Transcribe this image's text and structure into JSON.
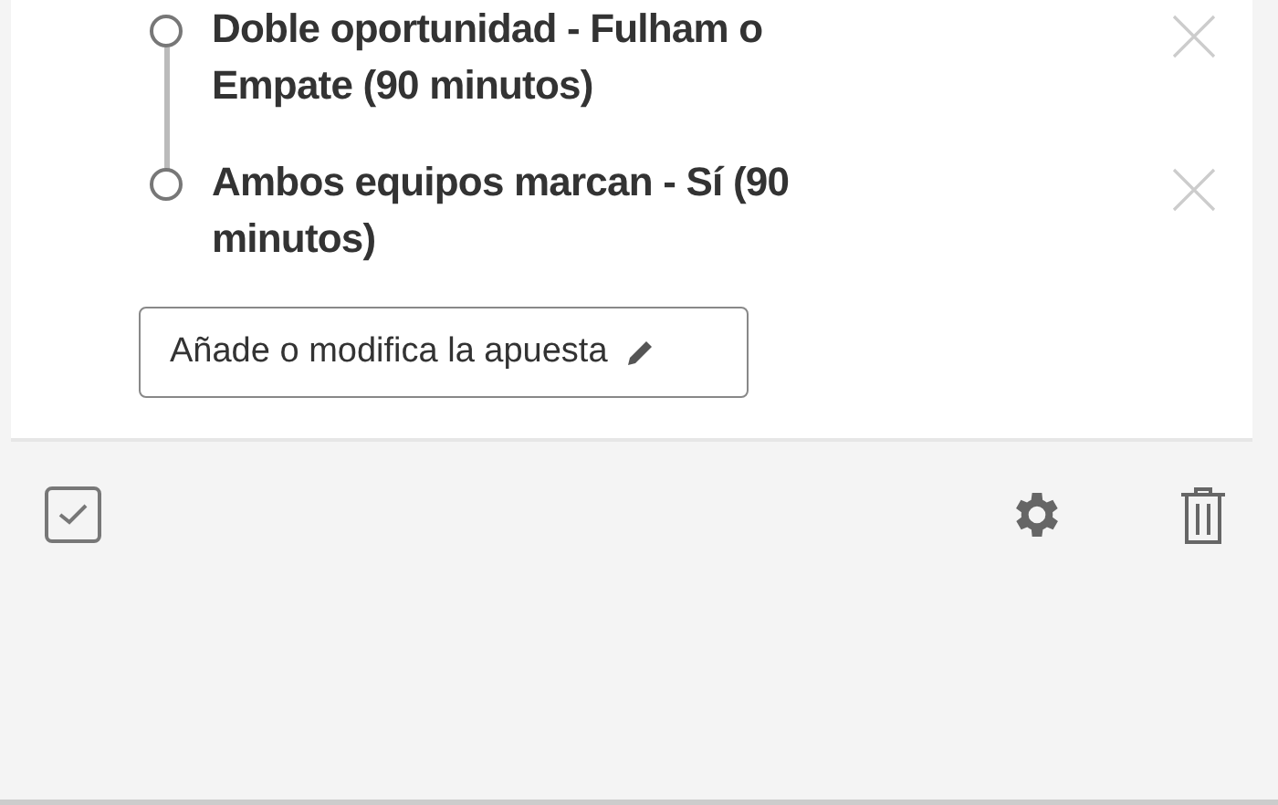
{
  "selections": [
    {
      "label": "Doble oportunidad - Fulham o Empate (90 minutos)"
    },
    {
      "label": "Ambos equipos marcan - Sí (90 minutos)"
    }
  ],
  "edit_button": {
    "label": "Añade o modifica la apuesta"
  }
}
